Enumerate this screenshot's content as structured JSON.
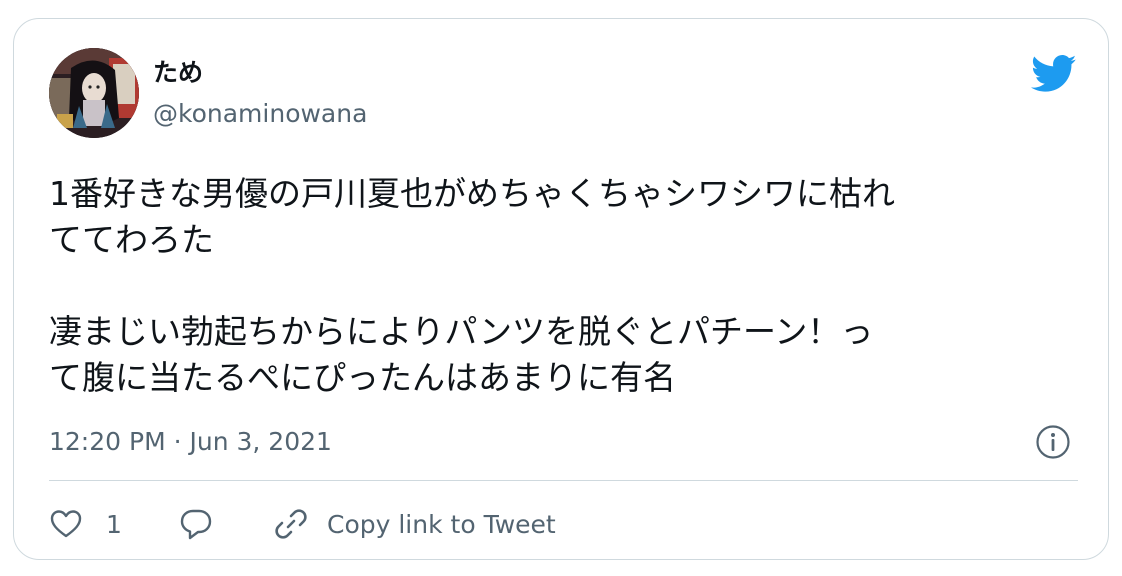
{
  "author": {
    "display_name": "ため",
    "handle": "@konaminowana"
  },
  "brand_icon": "twitter-bird-icon",
  "accent_color": "#1d9bf0",
  "tweet": {
    "lines": [
      "1番好きな男優の戸川夏也がめちゃくちゃシワシワに枯れ",
      "ててわろた",
      "",
      "凄まじい勃起ちからによりパンツを脱ぐとパチーン！っ",
      "て腹に当たるぺにぴったんはあまりに有名"
    ],
    "timestamp": "12:20 PM · Jun 3, 2021"
  },
  "actions": {
    "like_icon": "heart-icon",
    "like_count": "1",
    "reply_icon": "reply-bubble-icon",
    "copy_icon": "link-icon",
    "copy_label": "Copy link to Tweet"
  },
  "info_icon": "info-icon"
}
